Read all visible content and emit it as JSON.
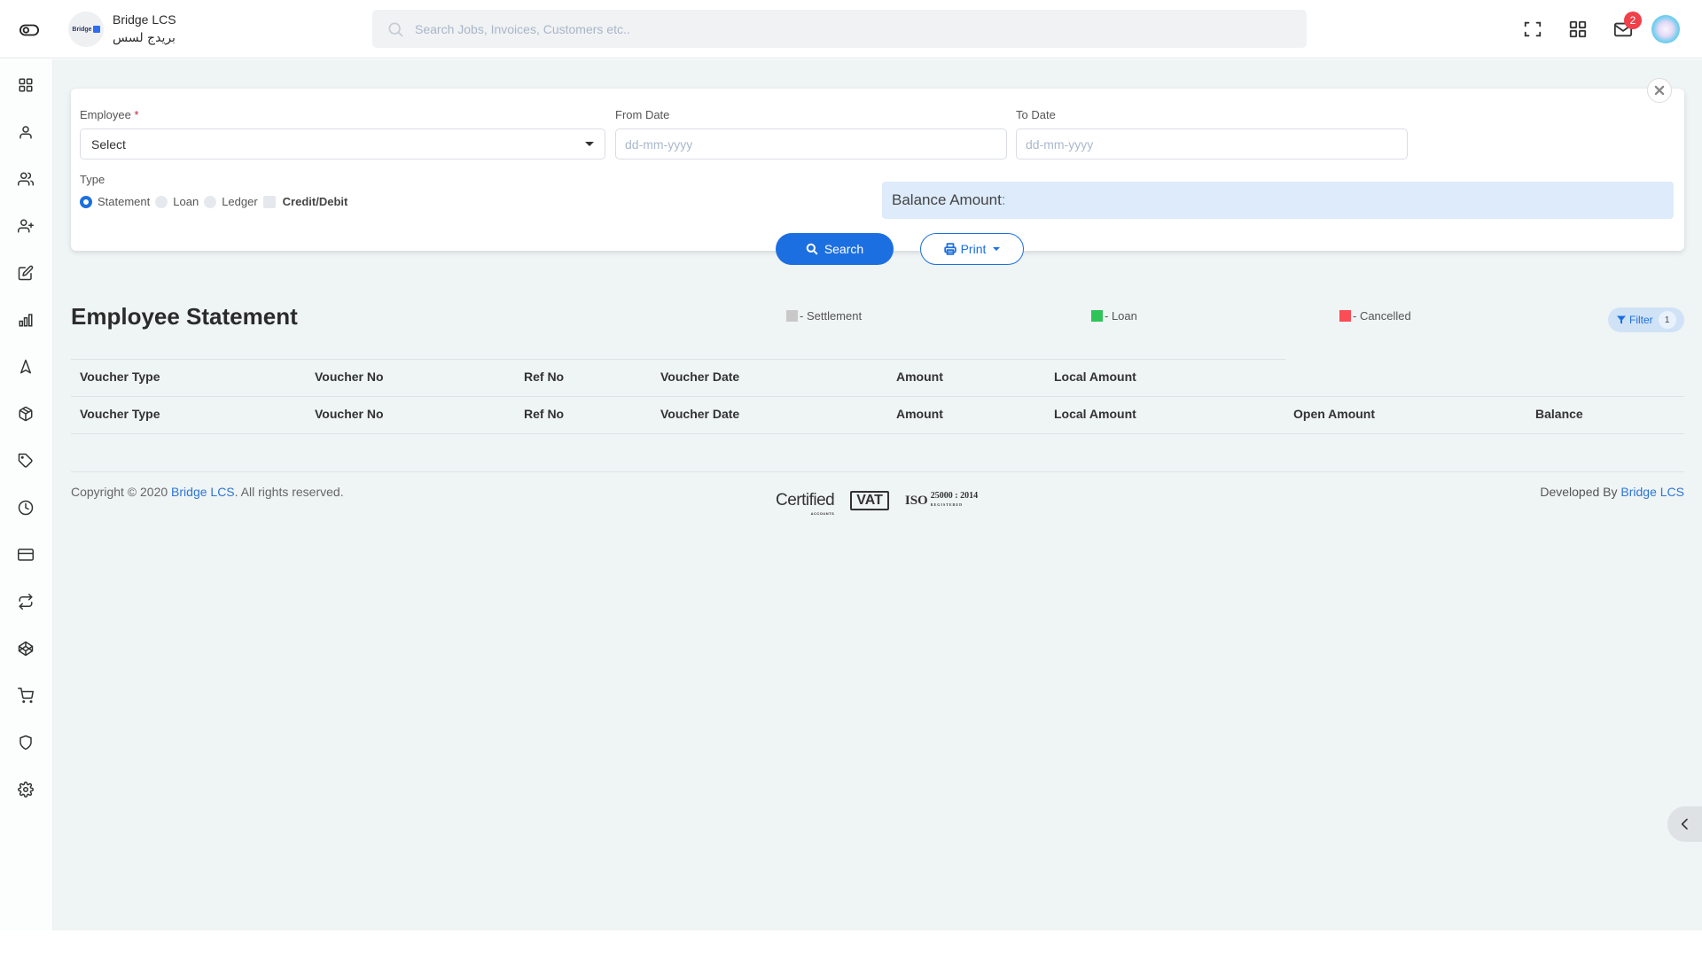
{
  "header": {
    "brand_name": "Bridge LCS",
    "brand_name_arabic": "بريدج لسس",
    "logo_text": "Bridge",
    "search_placeholder": "Search Jobs, Invoices, Customers etc..",
    "notification_count": "2",
    "icons": [
      "toggle-icon",
      "fullscreen-icon",
      "apps-grid-icon",
      "mail-icon",
      "avatar"
    ]
  },
  "sidebar": {
    "items": [
      {
        "name": "dashboard",
        "icon": "grid-icon"
      },
      {
        "name": "user",
        "icon": "user-icon"
      },
      {
        "name": "users",
        "icon": "users-icon"
      },
      {
        "name": "add-user",
        "icon": "user-plus-icon"
      },
      {
        "name": "edit",
        "icon": "edit-icon"
      },
      {
        "name": "reports",
        "icon": "bar-chart-icon"
      },
      {
        "name": "navigation",
        "icon": "navigation-icon"
      },
      {
        "name": "inventory",
        "icon": "box-icon"
      },
      {
        "name": "tags",
        "icon": "tag-icon"
      },
      {
        "name": "history",
        "icon": "clock-icon"
      },
      {
        "name": "payments",
        "icon": "credit-card-icon"
      },
      {
        "name": "transfers",
        "icon": "repeat-icon"
      },
      {
        "name": "codepen",
        "icon": "codepen-icon"
      },
      {
        "name": "sales",
        "icon": "shopping-cart-icon"
      },
      {
        "name": "security",
        "icon": "shield-icon"
      },
      {
        "name": "settings",
        "icon": "settings-icon"
      }
    ]
  },
  "filter": {
    "employee_label": "Employee",
    "required_mark": "*",
    "employee_value": "Select",
    "from_date_label": "From Date",
    "from_date_placeholder": "dd-mm-yyyy",
    "to_date_label": "To Date",
    "to_date_placeholder": "dd-mm-yyyy",
    "type_label": "Type",
    "type_options": [
      {
        "label": "Statement",
        "kind": "radio",
        "checked": true
      },
      {
        "label": "Loan",
        "kind": "radio",
        "checked": false
      },
      {
        "label": "Ledger",
        "kind": "radio",
        "checked": false
      },
      {
        "label": "Credit/Debit",
        "kind": "checkbox",
        "checked": false
      }
    ],
    "balance_label": "Balance Amount",
    "balance_colon": ":",
    "balance_value": "",
    "search_button": "Search",
    "print_button": "Print"
  },
  "statement": {
    "title": "Employee Statement",
    "legend": [
      {
        "label": "- Settlement",
        "color": "#c8c8c8"
      },
      {
        "label": "- Loan",
        "color": "#2fc45a"
      },
      {
        "label": "- Cancelled",
        "color": "#fb4d55"
      }
    ],
    "filter_button": "Filter",
    "filter_count": "1",
    "header_row_1": [
      "Voucher Type",
      "Voucher No",
      "Ref No",
      "Voucher Date",
      "Amount",
      "Local Amount"
    ],
    "header_row_2": [
      "Voucher Type",
      "Voucher No",
      "Ref No",
      "Voucher Date",
      "Amount",
      "Local Amount",
      "Open Amount",
      "Balance"
    ]
  },
  "footer": {
    "copyright_prefix": "Copyright © 2020 ",
    "copyright_link": "Bridge LCS",
    "copyright_suffix": ". All rights reserved.",
    "developed_prefix": "Developed By ",
    "developed_link": "Bridge LCS",
    "cert_certified": "Certified",
    "cert_accounts": "ACCOUNTS",
    "cert_vat": "VAT",
    "cert_iso": "ISO",
    "cert_iso_number": "25000 : 2014",
    "cert_iso_registered": "REGISTERED"
  },
  "colors": {
    "accent": "#1c6fe0",
    "background": "#eff4f4",
    "balance_bg": "#ddebfb",
    "badge": "#f0404a"
  }
}
